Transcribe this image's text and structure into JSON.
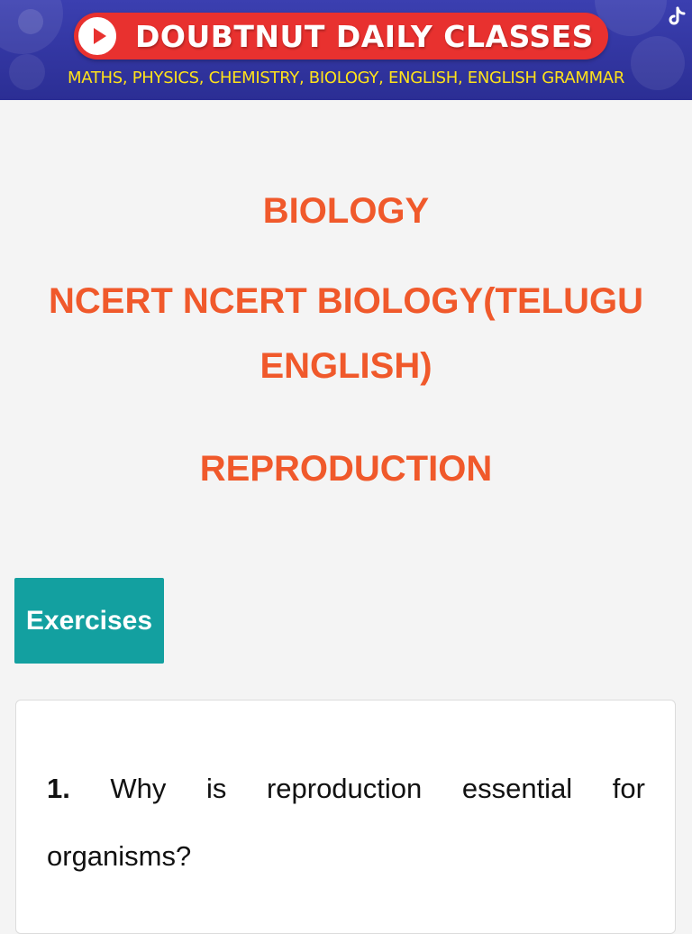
{
  "banner": {
    "title": "DOUBTNUT DAILY CLASSES",
    "subjects": "MATHS, PHYSICS, CHEMISTRY, BIOLOGY, ENGLISH, ENGLISH GRAMMAR",
    "play_icon": "play-icon",
    "social_icon": "tiktok-icon",
    "colors": {
      "background": "#2f33a0",
      "pill": "#e8312f",
      "subtitle": "#ffe21a"
    }
  },
  "header": {
    "subject": "BIOLOGY",
    "book": "NCERT NCERT BIOLOGY(TELUGU ENGLISH)",
    "chapter": "REPRODUCTION",
    "color": "#f0592b"
  },
  "tab": {
    "label": "Exercises",
    "color": "#13a0a0"
  },
  "question": {
    "number": "1.",
    "words_line1": [
      "Why",
      "is",
      "reproduction",
      "essential",
      "for"
    ],
    "line2": "organisms?"
  }
}
